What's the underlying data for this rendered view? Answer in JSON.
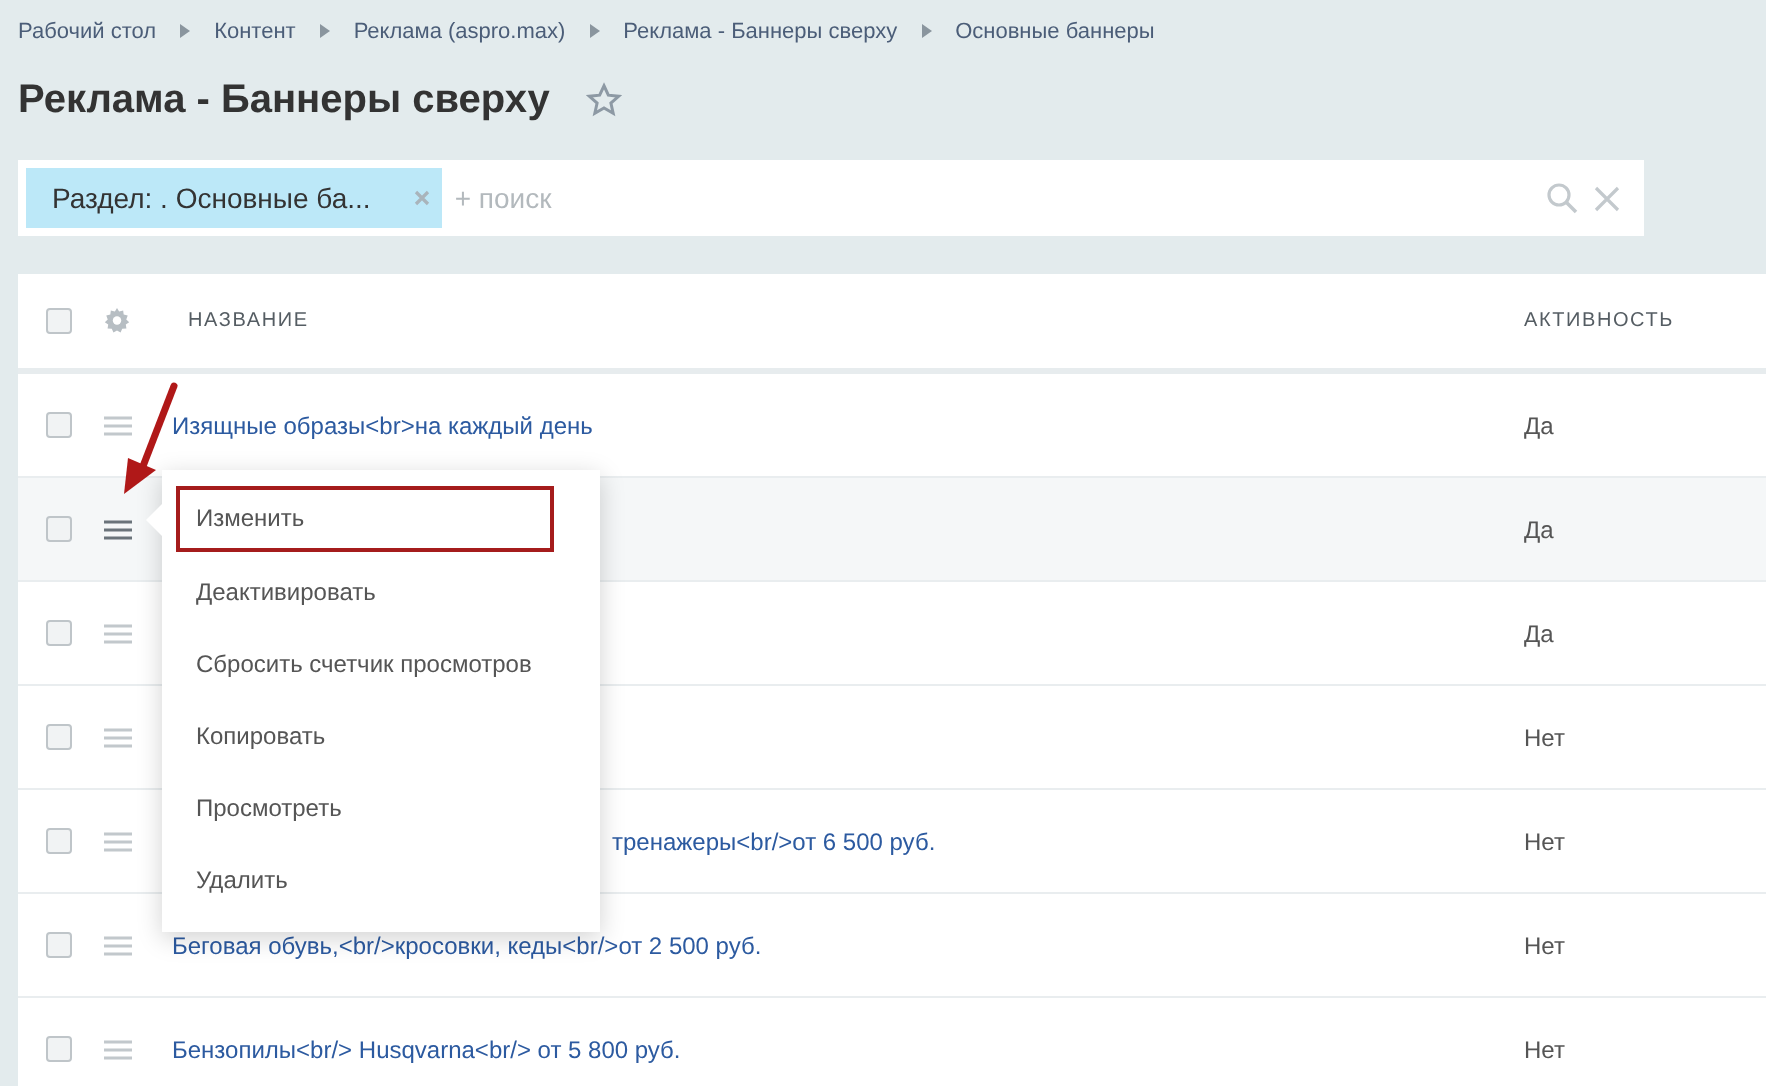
{
  "breadcrumbs": [
    "Рабочий стол",
    "Контент",
    "Реклама (aspro.max)",
    "Реклама - Баннеры сверху",
    "Основные баннеры"
  ],
  "title": "Реклама - Баннеры сверху",
  "filter": {
    "chip": "Раздел: . Основные ба...",
    "placeholder": "+ поиск"
  },
  "table": {
    "header_checked": false,
    "columns": [
      "НАЗВАНИЕ",
      "АКТИВНОСТЬ"
    ],
    "rows": [
      {
        "name": "Изящные образы<br>на каждый день",
        "active": "Да",
        "checked": false,
        "menu_open": false,
        "name_covered": false
      },
      {
        "active": "Да",
        "checked": false,
        "menu_open": true
      },
      {
        "active": "Да",
        "checked": false,
        "menu_open": false
      },
      {
        "active": "Нет",
        "checked": false,
        "menu_open": false
      },
      {
        "name": "тренажеры<br/>от 6 500 руб.",
        "active": "Нет",
        "checked": false,
        "menu_open": false,
        "name_covered": true
      },
      {
        "name": "Беговая обувь,<br/>кросовки, кеды<br/>от 2 500 руб.",
        "active": "Нет",
        "checked": false,
        "menu_open": false,
        "name_covered": false
      },
      {
        "name": "Бензопилы<br/> Husqvarna<br/> от 5 800 руб.",
        "active": "Нет",
        "checked": false,
        "menu_open": false,
        "name_covered": false
      }
    ]
  },
  "context_menu": [
    {
      "label": "Изменить",
      "highlighted": true
    },
    {
      "label": "Деактивировать",
      "highlighted": false
    },
    {
      "label": "Сбросить счетчик просмотров",
      "highlighted": false
    },
    {
      "label": "Копировать",
      "highlighted": false
    },
    {
      "label": "Просмотреть",
      "highlighted": false
    },
    {
      "label": "Удалить",
      "highlighted": false
    }
  ]
}
